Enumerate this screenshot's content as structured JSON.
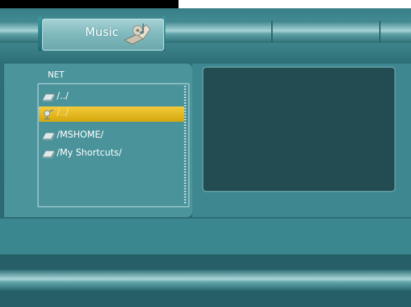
{
  "header": {
    "title": "Music",
    "title_icon": "music-note-disc-icon"
  },
  "browser": {
    "location_label": "NET",
    "items": [
      {
        "label": "/../",
        "icon": "folder-icon",
        "selected": false
      },
      {
        "label": "/../",
        "icon": "network-icon",
        "selected": true
      },
      {
        "label": "/MSHOME/",
        "icon": "folder-icon",
        "selected": false
      },
      {
        "label": "/My Shortcuts/",
        "icon": "folder-icon",
        "selected": false
      }
    ]
  },
  "colors": {
    "background": "#2c6a72",
    "selection": "#e8bb22",
    "preview_panel": "#234c52"
  }
}
